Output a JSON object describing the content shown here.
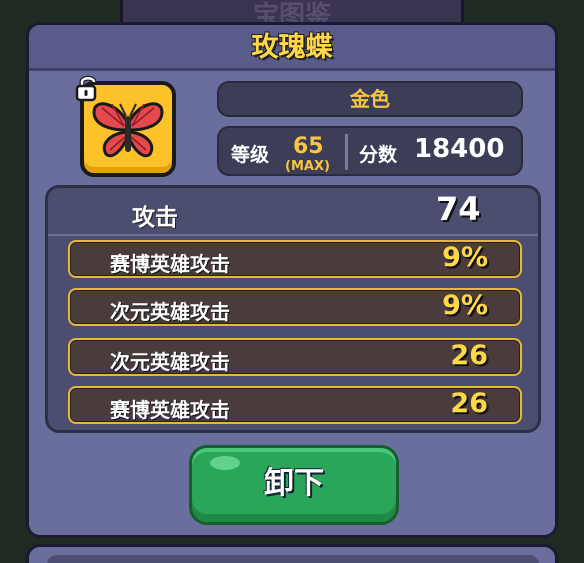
{
  "background_tab": {
    "label": "宝图鉴"
  },
  "item": {
    "name": "玫瑰蝶",
    "rarity": "金色",
    "level_label": "等级",
    "level": "65",
    "level_max": "(MAX)",
    "score_label": "分数",
    "score": "18400",
    "icon": "butterfly-icon",
    "lock": "unlocked-padlock-icon"
  },
  "stats": {
    "main": {
      "name": "攻击",
      "value": "74"
    },
    "subs": [
      {
        "name": "赛博英雄攻击",
        "value": "9%"
      },
      {
        "name": "次元英雄攻击",
        "value": "9%"
      },
      {
        "name": "次元英雄攻击",
        "value": "26"
      },
      {
        "name": "赛博英雄攻击",
        "value": "26"
      }
    ]
  },
  "actions": {
    "unequip_label": "卸下"
  },
  "colors": {
    "accent": "#ffd84a",
    "button": "#29a659",
    "panel": "#6a6e9c"
  }
}
